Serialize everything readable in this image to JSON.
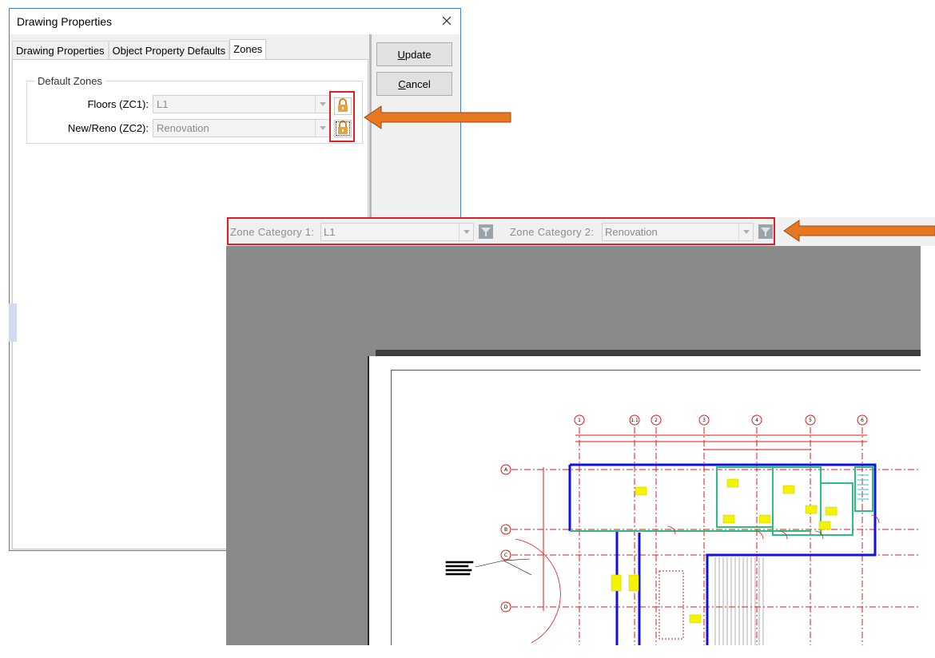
{
  "dialog": {
    "title": "Drawing Properties",
    "close_icon": "close-icon",
    "tabs": [
      {
        "label": "Drawing Properties",
        "active": false
      },
      {
        "label": "Object Property Defaults",
        "active": false
      },
      {
        "label": "Zones",
        "active": true
      }
    ],
    "group": {
      "legend": "Default Zones",
      "rows": [
        {
          "label": "Floors (ZC1):",
          "value": "L1",
          "lock_icon": "lock-icon"
        },
        {
          "label": "New/Reno (ZC2):",
          "value": "Renovation",
          "lock_icon": "lock-icon"
        }
      ]
    },
    "buttons": {
      "update_label": "pdate",
      "update_mnemonic": "U",
      "cancel_label": "ancel",
      "cancel_mnemonic": "C"
    }
  },
  "zone_toolbar": {
    "zc1_label": "Zone Category 1:",
    "zc1_value": "L1",
    "zc2_label": "Zone Category 2:",
    "zc2_value": "Renovation",
    "filter_icon": "filter-icon"
  },
  "colors": {
    "highlight": "#e02020",
    "arrow_fill": "#e87722",
    "arrow_stroke": "#9a4a12",
    "lock": "#e6a23c",
    "plan_red": "#e01818",
    "plan_blue": "#1010e0",
    "plan_green": "#28c080",
    "plan_yellow": "#f4f400"
  },
  "plan": {
    "grid_columns": [
      "1",
      "1.1",
      "2",
      "3",
      "4",
      "5",
      "6"
    ],
    "grid_rows": [
      "A",
      "B",
      "C",
      "D"
    ]
  }
}
